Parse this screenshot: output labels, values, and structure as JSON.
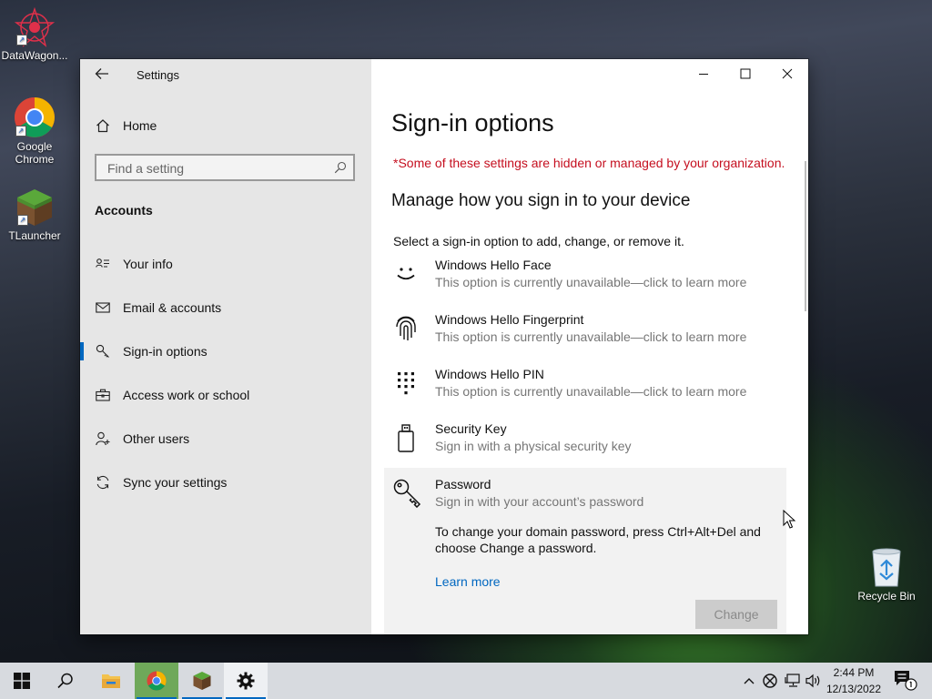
{
  "desktop": {
    "icons": [
      {
        "label": "DataWagon..."
      },
      {
        "label": "Google Chrome"
      },
      {
        "label": "TLauncher"
      },
      {
        "label": "Recycle Bin"
      }
    ]
  },
  "window": {
    "app_title": "Settings",
    "controls": {
      "minimize": "minimize-icon",
      "maximize": "maximize-icon",
      "close": "close-icon"
    }
  },
  "sidebar": {
    "home_label": "Home",
    "search_placeholder": "Find a setting",
    "section_title": "Accounts",
    "items": [
      {
        "label": "Your info",
        "icon": "contact-card-icon"
      },
      {
        "label": "Email & accounts",
        "icon": "mail-icon"
      },
      {
        "label": "Sign-in options",
        "icon": "key-icon",
        "active": true
      },
      {
        "label": "Access work or school",
        "icon": "briefcase-icon"
      },
      {
        "label": "Other users",
        "icon": "person-add-icon"
      },
      {
        "label": "Sync your settings",
        "icon": "sync-icon"
      }
    ]
  },
  "main": {
    "title": "Sign-in options",
    "managed_note": "*Some of these settings are hidden or managed by your organization.",
    "subheading": "Manage how you sign in to your device",
    "instruction": "Select a sign-in option to add, change, or remove it.",
    "options": [
      {
        "title": "Windows Hello Face",
        "subtitle": "This option is currently unavailable—click to learn more",
        "icon": "face-icon"
      },
      {
        "title": "Windows Hello Fingerprint",
        "subtitle": "This option is currently unavailable—click to learn more",
        "icon": "fingerprint-icon"
      },
      {
        "title": "Windows Hello PIN",
        "subtitle": "This option is currently unavailable—click to learn more",
        "icon": "pin-keypad-icon"
      },
      {
        "title": "Security Key",
        "subtitle": "Sign in with a physical security key",
        "icon": "usb-key-icon"
      },
      {
        "title": "Password",
        "subtitle": "Sign in with your account’s password",
        "icon": "password-key-icon",
        "detail": "To change your domain password, press Ctrl+Alt+Del and choose Change a password.",
        "learn_more": "Learn more",
        "button": "Change"
      }
    ]
  },
  "taskbar": {
    "time": "2:44 PM",
    "date": "12/13/2022",
    "accent": "#0067c0"
  }
}
